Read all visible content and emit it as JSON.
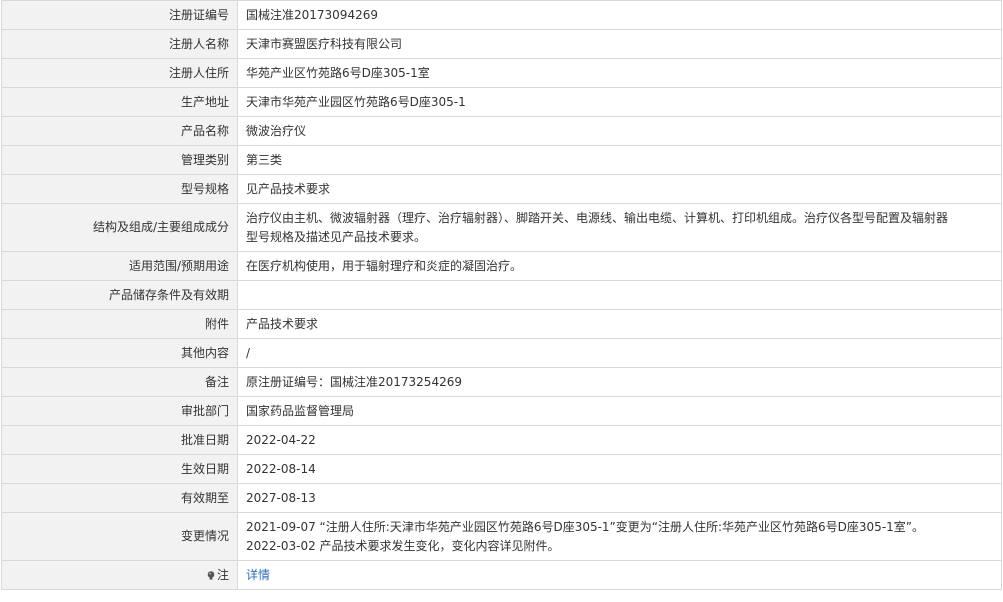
{
  "rows": [
    {
      "label": "注册证编号",
      "value": "国械注准20173094269"
    },
    {
      "label": "注册人名称",
      "value": "天津市赛盟医疗科技有限公司"
    },
    {
      "label": "注册人住所",
      "value": "华苑产业区竹苑路6号D座305-1室"
    },
    {
      "label": "生产地址",
      "value": "天津市华苑产业园区竹苑路6号D座305-1"
    },
    {
      "label": "产品名称",
      "value": "微波治疗仪"
    },
    {
      "label": "管理类别",
      "value": "第三类"
    },
    {
      "label": "型号规格",
      "value": "见产品技术要求"
    },
    {
      "label": "结构及组成/主要组成成分",
      "value_lines": [
        "治疗仪由主机、微波辐射器（理疗、治疗辐射器）、脚踏开关、电源线、输出电缆、计算机、打印机组成。治疗仪各型号配置及辐射器",
        "型号规格及描述见产品技术要求。"
      ]
    },
    {
      "label": "适用范围/预期用途",
      "value": "在医疗机构使用，用于辐射理疗和炎症的凝固治疗。"
    },
    {
      "label": "产品储存条件及有效期",
      "value": ""
    },
    {
      "label": "附件",
      "value": "产品技术要求"
    },
    {
      "label": "其他内容",
      "value": "/"
    },
    {
      "label": "备注",
      "value": "原注册证编号：国械注准20173254269"
    },
    {
      "label": "审批部门",
      "value": "国家药品监督管理局"
    },
    {
      "label": "批准日期",
      "value": "2022-04-22"
    },
    {
      "label": "生效日期",
      "value": "2022-08-14"
    },
    {
      "label": "有效期至",
      "value": "2027-08-13"
    },
    {
      "label": "变更情况",
      "value_lines": [
        "2021-09-07 “注册人住所:天津市华苑产业园区竹苑路6号D座305-1”变更为“注册人住所:华苑产业区竹苑路6号D座305-1室”。",
        "2022-03-02 产品技术要求发生变化，变化内容详见附件。"
      ]
    }
  ],
  "note": {
    "label": "注",
    "icon": "bulb-icon",
    "link_text": "详情"
  }
}
